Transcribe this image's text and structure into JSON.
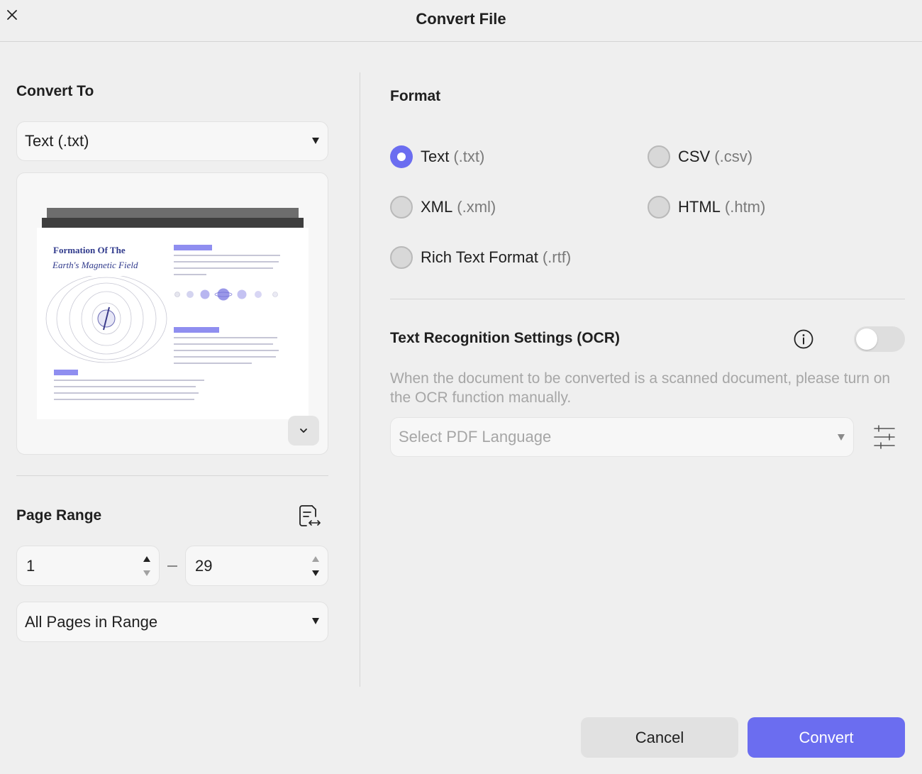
{
  "window": {
    "title": "Convert File"
  },
  "left": {
    "convert_to_title": "Convert To",
    "convert_to_value": "Text (.txt)",
    "preview": {
      "doc_title_line1": "Formation Of The",
      "doc_title_line2": "Earth's Magnetic Field"
    },
    "page_range_title": "Page Range",
    "range_from": "1",
    "range_to": "29",
    "pages_option": "All Pages in Range"
  },
  "format": {
    "title": "Format",
    "options": [
      {
        "name": "Text",
        "ext": "(.txt)",
        "selected": true
      },
      {
        "name": "CSV",
        "ext": "(.csv)",
        "selected": false
      },
      {
        "name": "XML",
        "ext": "(.xml)",
        "selected": false
      },
      {
        "name": "HTML",
        "ext": "(.htm)",
        "selected": false
      },
      {
        "name": "Rich Text Format",
        "ext": "(.rtf)",
        "selected": false
      }
    ]
  },
  "ocr": {
    "title": "Text Recognition Settings (OCR)",
    "enabled": false,
    "description": "When the document to be converted is a scanned document, please turn on the OCR function manually.",
    "language_placeholder": "Select PDF Language"
  },
  "buttons": {
    "cancel": "Cancel",
    "convert": "Convert"
  },
  "colors": {
    "accent": "#6b6df0",
    "background": "#efefef",
    "muted_text": "#a6a6a6"
  },
  "icons": [
    "close-icon",
    "chevron-down-icon",
    "page-range-icon",
    "info-icon",
    "sliders-icon"
  ]
}
